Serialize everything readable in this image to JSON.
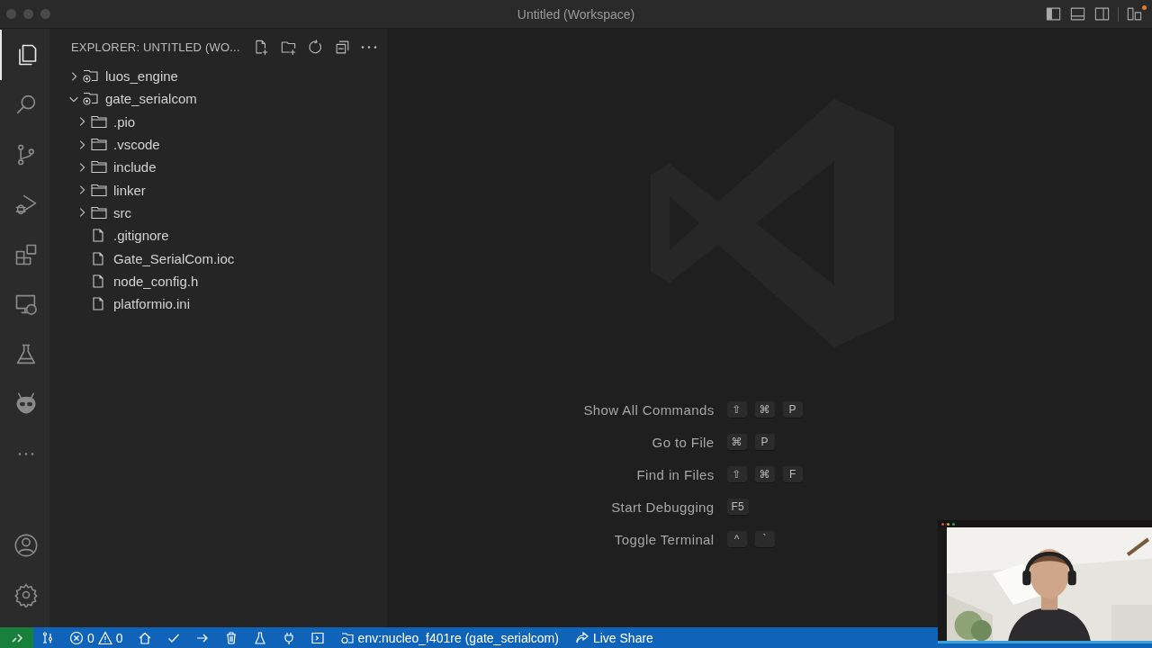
{
  "window": {
    "title": "Untitled (Workspace)"
  },
  "title_bar_actions": [
    {
      "kind": "sidebar-left"
    },
    {
      "kind": "panel"
    },
    {
      "kind": "sidebar-right"
    },
    {
      "kind": "layout",
      "badge": true
    }
  ],
  "activity_bar": {
    "items": [
      {
        "kind": "files",
        "selected": true
      },
      {
        "kind": "search",
        "selected": false
      },
      {
        "kind": "scm",
        "selected": false
      },
      {
        "kind": "debug",
        "selected": false
      },
      {
        "kind": "extensions",
        "selected": false
      },
      {
        "kind": "remote",
        "selected": false
      },
      {
        "kind": "flask",
        "selected": false
      },
      {
        "kind": "alien",
        "selected": false
      },
      {
        "kind": "more",
        "selected": false
      }
    ],
    "bottom_items": [
      {
        "kind": "account"
      },
      {
        "kind": "settings"
      }
    ]
  },
  "sidebar": {
    "title": "EXPLORER: UNTITLED (WO...",
    "actions": [
      {
        "kind": "new-file"
      },
      {
        "kind": "new-folder"
      },
      {
        "kind": "refresh"
      },
      {
        "kind": "collapse"
      },
      {
        "kind": "more"
      }
    ],
    "tree": [
      {
        "label": "luos_engine",
        "kind": "root",
        "expanded": false
      },
      {
        "label": "gate_serialcom",
        "kind": "root",
        "expanded": true,
        "children": [
          {
            "label": ".pio",
            "kind": "folder",
            "expanded": false
          },
          {
            "label": ".vscode",
            "kind": "folder",
            "expanded": false
          },
          {
            "label": "include",
            "kind": "folder",
            "expanded": false
          },
          {
            "label": "linker",
            "kind": "folder",
            "expanded": false
          },
          {
            "label": "src",
            "kind": "folder",
            "expanded": false
          },
          {
            "label": ".gitignore",
            "kind": "file"
          },
          {
            "label": "Gate_SerialCom.ioc",
            "kind": "file"
          },
          {
            "label": "node_config.h",
            "kind": "file"
          },
          {
            "label": "platformio.ini",
            "kind": "file"
          }
        ]
      }
    ]
  },
  "editor": {
    "shortcuts": [
      {
        "label": "Show All Commands",
        "keys": [
          "⇧",
          "⌘",
          "P"
        ]
      },
      {
        "label": "Go to File",
        "keys": [
          "⌘",
          "P"
        ]
      },
      {
        "label": "Find in Files",
        "keys": [
          "⇧",
          "⌘",
          "F"
        ]
      },
      {
        "label": "Start Debugging",
        "keys": [
          "F5"
        ]
      },
      {
        "label": "Toggle Terminal",
        "keys": [
          "^",
          "`"
        ]
      }
    ]
  },
  "status_bar": {
    "items": [
      {
        "kind": "remote"
      },
      {
        "kind": "ports"
      },
      {
        "kind": "problems",
        "errors": "0",
        "warnings": "0"
      },
      {
        "kind": "home"
      },
      {
        "kind": "check"
      },
      {
        "kind": "arrow"
      },
      {
        "kind": "trash"
      },
      {
        "kind": "flask"
      },
      {
        "kind": "plug"
      },
      {
        "kind": "terminal"
      },
      {
        "kind": "env",
        "text": "env:nucleo_f401re (gate_serialcom)"
      },
      {
        "kind": "live-share",
        "text": "Live Share"
      }
    ]
  }
}
